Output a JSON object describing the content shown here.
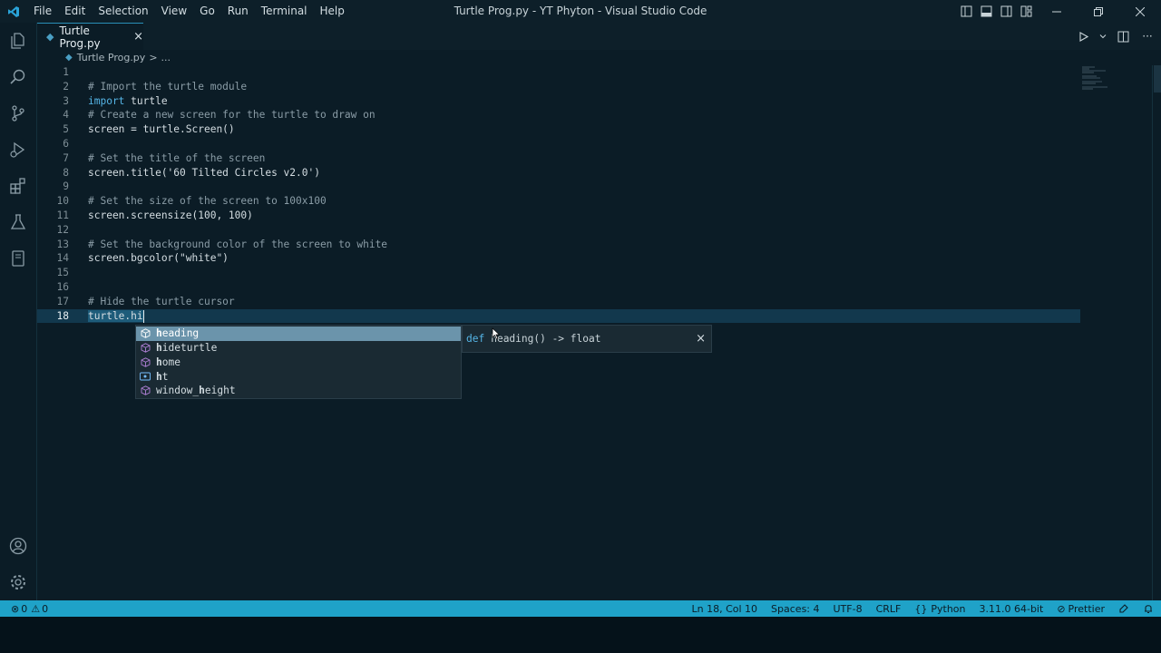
{
  "titlebar": {
    "menu": [
      "File",
      "Edit",
      "Selection",
      "View",
      "Go",
      "Run",
      "Terminal",
      "Help"
    ],
    "window_title": "Turtle Prog.py - YT Phyton - Visual Studio Code"
  },
  "tab": {
    "label": "Turtle Prog.py",
    "close": "×"
  },
  "breadcrumb": {
    "file": "Turtle Prog.py",
    "separator": ">",
    "more": "..."
  },
  "editor": {
    "lines": [
      {
        "n": "1",
        "code": ""
      },
      {
        "n": "2",
        "code": "# Import the turtle module"
      },
      {
        "n": "3",
        "kw": "import",
        "code": " turtle"
      },
      {
        "n": "4",
        "code": "# Create a new screen for the turtle to draw on"
      },
      {
        "n": "5",
        "code": "screen = turtle.Screen()"
      },
      {
        "n": "6",
        "code": ""
      },
      {
        "n": "7",
        "code": "# Set the title of the screen"
      },
      {
        "n": "8",
        "code": "screen.title('60 Tilted Circles v2.0')"
      },
      {
        "n": "9",
        "code": ""
      },
      {
        "n": "10",
        "code": "# Set the size of the screen to 100x100"
      },
      {
        "n": "11",
        "code": "screen.screensize(100, 100)"
      },
      {
        "n": "12",
        "code": ""
      },
      {
        "n": "13",
        "code": "# Set the background color of the screen to white"
      },
      {
        "n": "14",
        "code": "screen.bgcolor(\"white\")"
      },
      {
        "n": "15",
        "code": ""
      },
      {
        "n": "16",
        "code": ""
      },
      {
        "n": "17",
        "code": "# Hide the turtle cursor"
      },
      {
        "n": "18",
        "code": "turtle.hi"
      }
    ]
  },
  "suggest": {
    "items": [
      {
        "prefix": "h",
        "rest": "eading",
        "kind": "method"
      },
      {
        "prefix": "h",
        "rest": "ideturtle",
        "kind": "method"
      },
      {
        "prefix": "h",
        "rest": "ome",
        "kind": "method"
      },
      {
        "prefix": "h",
        "rest": "t",
        "kind": "variable"
      },
      {
        "pre": "window_",
        "prefix": "h",
        "rest": "eight",
        "kind": "method"
      }
    ],
    "detail": {
      "kw": "def",
      "signature": "heading() -> float",
      "close": "×"
    }
  },
  "statusbar": {
    "errors": "0",
    "warnings": "0",
    "position": "Ln 18, Col 10",
    "spaces": "Spaces: 4",
    "encoding": "UTF-8",
    "eol": "CRLF",
    "language": "Python",
    "interpreter": "3.11.0 64-bit",
    "formatter": "Prettier"
  },
  "colors": {
    "accent": "#1fa2c8",
    "background": "#0b1c26",
    "keyword": "#55b5e6"
  }
}
